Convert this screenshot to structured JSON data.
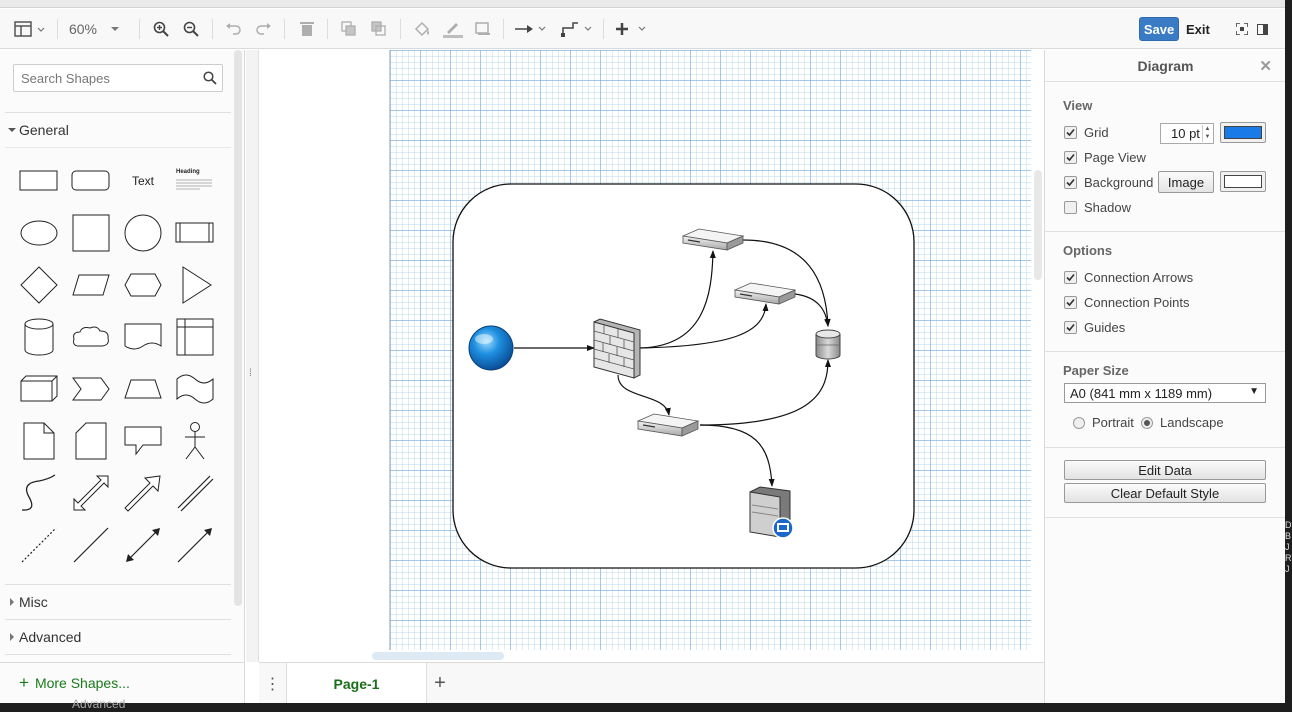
{
  "toolbar": {
    "zoom": "60%",
    "save_label": "Save",
    "exit_label": "Exit"
  },
  "sidebar": {
    "search_placeholder": "Search Shapes",
    "sections": {
      "general": "General",
      "misc": "Misc",
      "advanced": "Advanced"
    },
    "text_shape_label": "Text",
    "heading_shape_label": "Heading",
    "more_shapes": "More Shapes..."
  },
  "pages": {
    "current": "Page-1"
  },
  "format_panel": {
    "title": "Diagram",
    "view": {
      "title": "View",
      "grid_label": "Grid",
      "grid_checked": true,
      "grid_size": "10 pt",
      "grid_color": "#1a7be8",
      "page_view_label": "Page View",
      "page_view_checked": true,
      "background_label": "Background",
      "background_checked": true,
      "image_button": "Image",
      "background_color": "#ffffff",
      "shadow_label": "Shadow",
      "shadow_checked": false
    },
    "options": {
      "title": "Options",
      "connection_arrows": "Connection Arrows",
      "connection_points": "Connection Points",
      "guides": "Guides"
    },
    "paper": {
      "title": "Paper Size",
      "size": "A0 (841 mm x 1189 mm)",
      "portrait": "Portrait",
      "landscape": "Landscape",
      "orientation": "landscape"
    },
    "buttons": {
      "edit_data": "Edit Data",
      "clear_default_style": "Clear Default Style"
    }
  },
  "background_text": "Advanced"
}
